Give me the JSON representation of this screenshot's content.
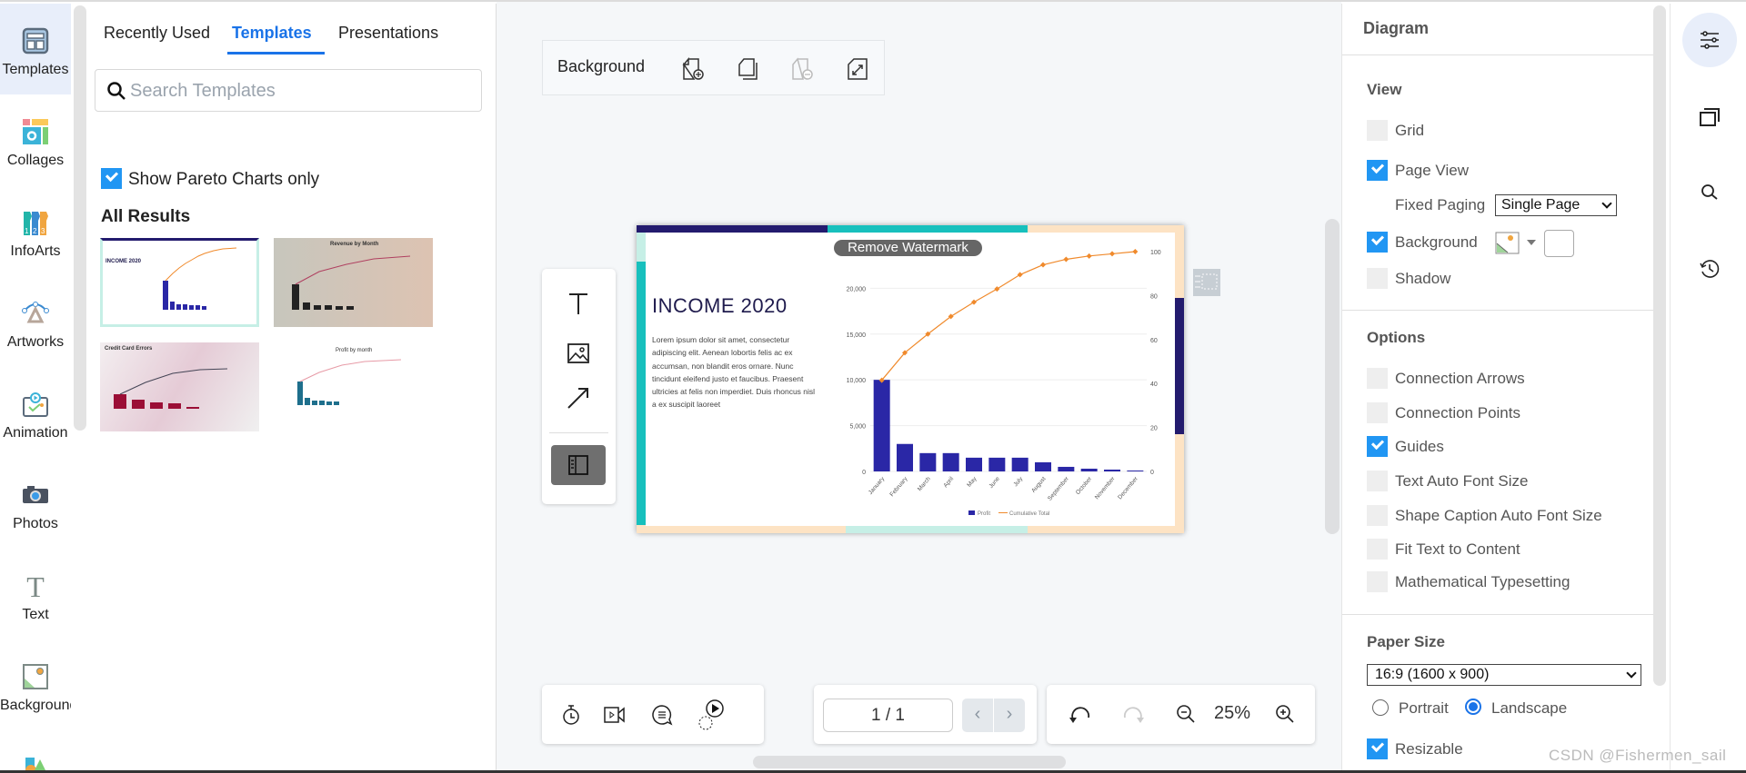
{
  "left_nav": {
    "items": [
      {
        "label": "Templates",
        "icon": "templates-icon",
        "active": true
      },
      {
        "label": "Collages",
        "icon": "collages-icon"
      },
      {
        "label": "InfoArts",
        "icon": "infoarts-icon"
      },
      {
        "label": "Artworks",
        "icon": "artworks-icon"
      },
      {
        "label": "Animation",
        "icon": "animation-icon"
      },
      {
        "label": "Photos",
        "icon": "camera-icon"
      },
      {
        "label": "Text",
        "icon": "text-icon"
      },
      {
        "label": "Background",
        "icon": "image-icon"
      }
    ]
  },
  "panel": {
    "tabs": [
      {
        "label": "Recently Used"
      },
      {
        "label": "Templates",
        "active": true
      },
      {
        "label": "Presentations"
      }
    ],
    "search": {
      "placeholder": "Search Templates",
      "value": ""
    },
    "filter": {
      "label": "Show Pareto Charts only",
      "checked": true
    },
    "results_heading": "All Results",
    "thumbnails": [
      {
        "title": "INCOME 2020"
      },
      {
        "title": "Revenue by Month"
      },
      {
        "title": "Credit Card Errors"
      },
      {
        "title": "Profit by month"
      }
    ]
  },
  "canvas": {
    "toolbar": {
      "background_label": "Background",
      "icons": [
        "add-page-icon",
        "duplicate-page-icon",
        "remove-page-icon",
        "page-size-icon"
      ]
    },
    "palette": [
      "text-tool-icon",
      "image-tool-icon",
      "arrow-tool-icon",
      "panel-toggle-icon"
    ],
    "watermark_button": "Remove Watermark",
    "slide": {
      "title": "INCOME 2020",
      "body": "Lorem ipsum dolor sit amet, consectetur adipiscing elit. Aenean lobortis felis ac ex accumsan, non blandit eros ornare. Nunc tincidunt eleifend justo et faucibus. Praesent ultricies at felis non imperdiet. Duis rhoncus nisl a ex suscipit laoreet",
      "colors": {
        "navy": "#231b6e",
        "teal": "#17c0bd",
        "mint": "#c6efe6",
        "peach": "#fde3c4"
      }
    },
    "bottom_toolbar": {
      "icons": [
        "timer-icon",
        "video-icon",
        "comment-icon",
        "slideshow-icon"
      ],
      "page": "1 / 1",
      "zoom": "25%"
    }
  },
  "chart_data": {
    "type": "bar+line",
    "categories": [
      "January",
      "February",
      "March",
      "April",
      "May",
      "June",
      "July",
      "August",
      "September",
      "October",
      "November",
      "December"
    ],
    "series": [
      {
        "name": "Profit",
        "type": "bar",
        "axis": "left",
        "color": "#2a27a6",
        "values": [
          10000,
          3000,
          2000,
          2000,
          1500,
          1500,
          1500,
          1000,
          500,
          300,
          200,
          100
        ]
      },
      {
        "name": "Cumulative Total",
        "type": "line",
        "axis": "right",
        "color": "#f08a2c",
        "values": [
          41.5,
          54,
          62.5,
          70.5,
          77,
          83,
          89.5,
          94,
          96.5,
          98,
          99,
          100
        ]
      }
    ],
    "left_axis": {
      "ticks": [
        "0",
        "5,000",
        "10,000",
        "15,000",
        "20,000"
      ],
      "range": [
        0,
        24000
      ]
    },
    "right_axis": {
      "ticks": [
        "0",
        "20",
        "40",
        "60",
        "80",
        "100"
      ],
      "range": [
        0,
        100
      ]
    },
    "grid": true,
    "legend": "bottom"
  },
  "right_panel": {
    "title": "Diagram",
    "view": {
      "heading": "View",
      "grid": {
        "label": "Grid",
        "checked": false
      },
      "page_view": {
        "label": "Page View",
        "checked": true
      },
      "fixed_paging": {
        "label": "Fixed Paging",
        "value": "Single Page"
      },
      "background": {
        "label": "Background",
        "checked": true
      },
      "shadow": {
        "label": "Shadow",
        "checked": false
      }
    },
    "options": {
      "heading": "Options",
      "items": [
        {
          "label": "Connection Arrows",
          "checked": false
        },
        {
          "label": "Connection Points",
          "checked": false
        },
        {
          "label": "Guides",
          "checked": true
        },
        {
          "label": "Text Auto Font Size",
          "checked": false
        },
        {
          "label": "Shape Caption Auto Font Size",
          "checked": false
        },
        {
          "label": "Fit Text to Content",
          "checked": false
        },
        {
          "label": "Mathematical Typesetting",
          "checked": false
        }
      ]
    },
    "paper": {
      "heading": "Paper Size",
      "value": "16:9 (1600 x 900)",
      "portrait": "Portrait",
      "landscape": "Landscape",
      "orientation": "Landscape",
      "resizable": {
        "label": "Resizable",
        "checked": true
      }
    }
  },
  "right_icons": [
    "settings-sliders-icon",
    "pages-icon",
    "search-icon",
    "history-icon"
  ],
  "credit": "CSDN @Fishermen_sail"
}
